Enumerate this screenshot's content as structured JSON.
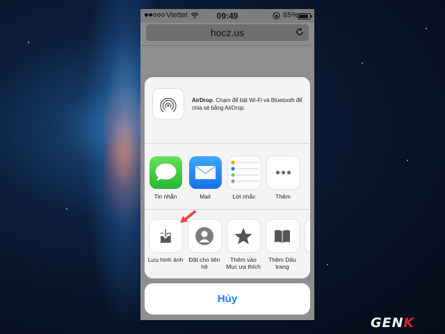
{
  "status_bar": {
    "carrier": "Viettel",
    "time": "09:49",
    "battery": "85%",
    "battery_level": 0.85
  },
  "browser": {
    "url": "hocz.us"
  },
  "airdrop": {
    "title": "AirDrop",
    "description": ". Chạm để bật Wi-Fi và Bluetooth để chia sẻ bằng AirDrop."
  },
  "share_apps": [
    {
      "label": "Tin nhắn",
      "icon": "messages-icon"
    },
    {
      "label": "Mail",
      "icon": "mail-icon"
    },
    {
      "label": "Lời nhắc",
      "icon": "reminders-icon"
    },
    {
      "label": "Thêm",
      "icon": "more-icon"
    }
  ],
  "actions": [
    {
      "label": "Lưu hình ảnh",
      "icon": "save-image-icon"
    },
    {
      "label": "Đặt cho liên hệ",
      "icon": "assign-to-contact-icon"
    },
    {
      "label": "Thêm vào Mục ưa thích",
      "icon": "favorites-star-icon"
    },
    {
      "label": "Thêm Dấu trang",
      "icon": "bookmark-book-icon"
    },
    {
      "label": "T",
      "icon": "partial-action"
    }
  ],
  "cancel_label": "Hủy",
  "watermark": "GENK",
  "colors": {
    "accent_blue": "#1b7cf2",
    "messages_green": "#4cd964",
    "mail_blue": "#1b6ee9",
    "arrow_red": "#e8473f"
  }
}
